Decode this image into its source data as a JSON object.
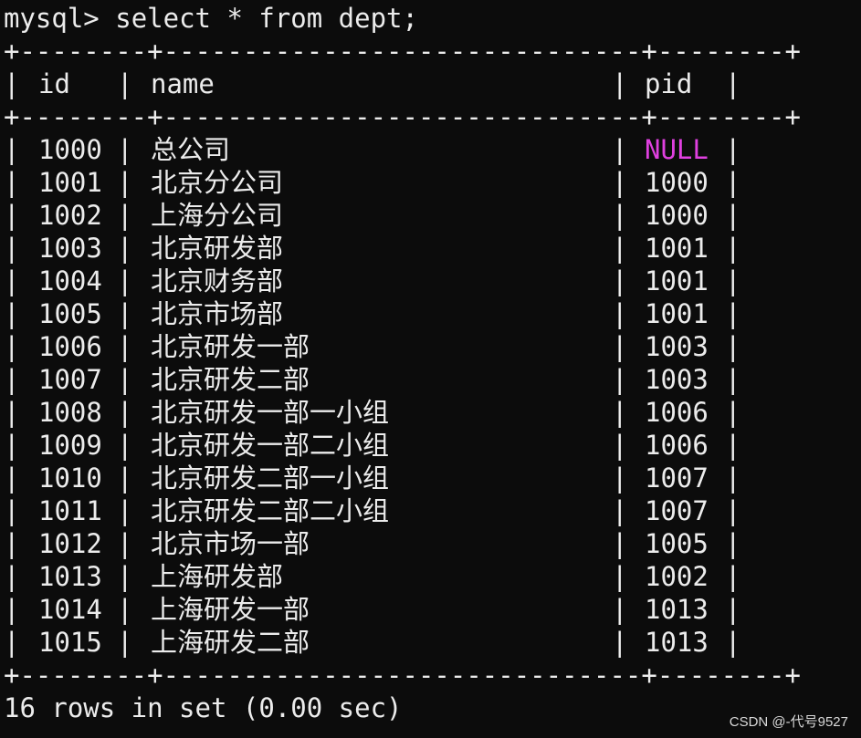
{
  "prompt": "mysql>",
  "command": "select * from dept;",
  "border": "+--------+------------------------------+--------+",
  "columns": {
    "id": "id",
    "name": "name",
    "pid": "pid"
  },
  "rows": [
    {
      "id": "1000",
      "name": "总公司",
      "pid": "NULL"
    },
    {
      "id": "1001",
      "name": "北京分公司",
      "pid": "1000"
    },
    {
      "id": "1002",
      "name": "上海分公司",
      "pid": "1000"
    },
    {
      "id": "1003",
      "name": "北京研发部",
      "pid": "1001"
    },
    {
      "id": "1004",
      "name": "北京财务部",
      "pid": "1001"
    },
    {
      "id": "1005",
      "name": "北京市场部",
      "pid": "1001"
    },
    {
      "id": "1006",
      "name": "北京研发一部",
      "pid": "1003"
    },
    {
      "id": "1007",
      "name": "北京研发二部",
      "pid": "1003"
    },
    {
      "id": "1008",
      "name": "北京研发一部一小组",
      "pid": "1006"
    },
    {
      "id": "1009",
      "name": "北京研发一部二小组",
      "pid": "1006"
    },
    {
      "id": "1010",
      "name": "北京研发二部一小组",
      "pid": "1007"
    },
    {
      "id": "1011",
      "name": "北京研发二部二小组",
      "pid": "1007"
    },
    {
      "id": "1012",
      "name": "北京市场一部",
      "pid": "1005"
    },
    {
      "id": "1013",
      "name": "上海研发部",
      "pid": "1002"
    },
    {
      "id": "1014",
      "name": "上海研发一部",
      "pid": "1013"
    },
    {
      "id": "1015",
      "name": "上海研发二部",
      "pid": "1013"
    }
  ],
  "result_summary": "16 rows in set (0.00 sec)",
  "watermark": "CSDN @-代号9527",
  "colors": {
    "background": "#0c0c0c",
    "text": "#ececec",
    "null": "#e040e0"
  }
}
